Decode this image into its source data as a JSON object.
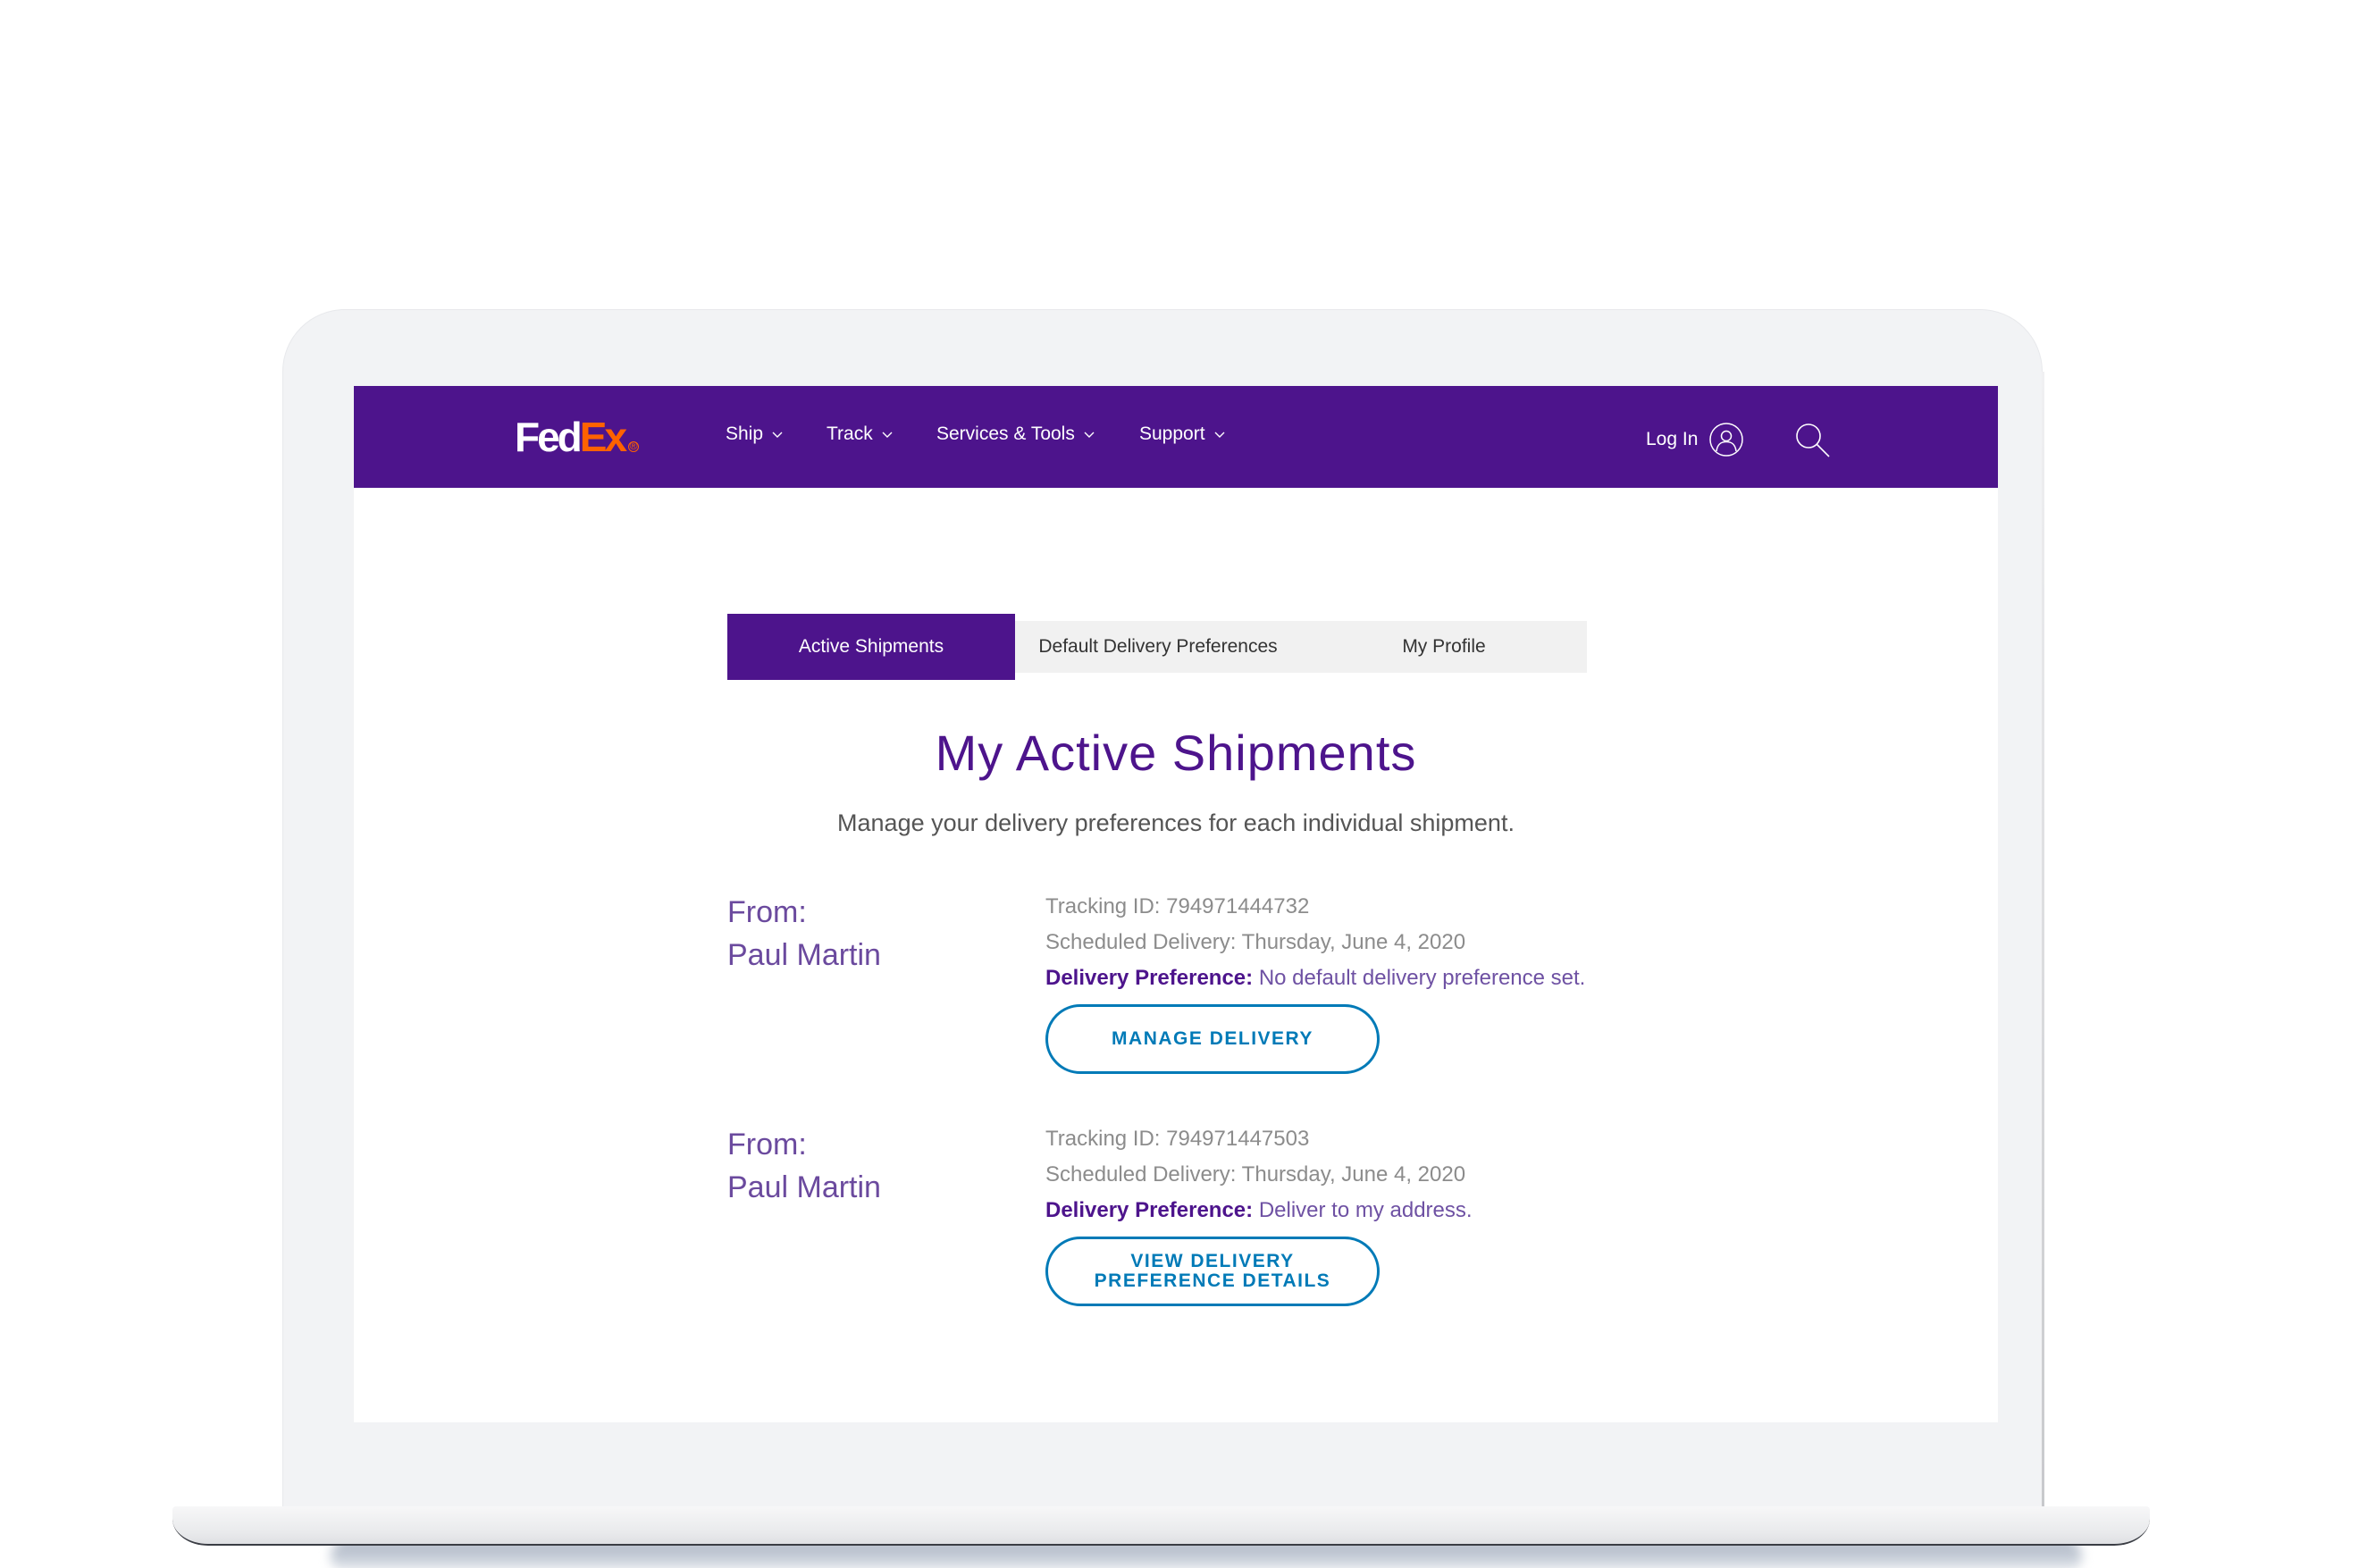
{
  "brand": {
    "logo_part1": "Fed",
    "logo_part2": "Ex",
    "logo_registered": "®",
    "colors": {
      "purple": "#4D148C",
      "orange": "#FF6200",
      "button_blue": "#007AB7"
    }
  },
  "nav": {
    "items": [
      {
        "label": "Ship",
        "icon": "chevron-down-icon"
      },
      {
        "label": "Track",
        "icon": "chevron-down-icon"
      },
      {
        "label": "Services & Tools",
        "icon": "chevron-down-icon"
      },
      {
        "label": "Support",
        "icon": "chevron-down-icon"
      }
    ],
    "login_label": "Log In",
    "login_icon": "user-icon",
    "search_icon": "search-icon"
  },
  "tabs": [
    {
      "label": "Active Shipments",
      "active": true
    },
    {
      "label": "Default Delivery Preferences",
      "active": false
    },
    {
      "label": "My Profile",
      "active": false
    }
  ],
  "page": {
    "title": "My Active Shipments",
    "subtitle": "Manage your delivery preferences for each individual shipment."
  },
  "shipments": [
    {
      "from_label": "From:",
      "sender": "Paul Martin",
      "tracking_id": "Tracking ID: 794971444732",
      "scheduled_delivery": "Scheduled Delivery: Thursday, June 4, 2020",
      "preference_label": "Delivery Preference:",
      "preference_value": "No default delivery preference set.",
      "button_line1": "MANAGE DELIVERY",
      "button_line2": ""
    },
    {
      "from_label": "From:",
      "sender": "Paul Martin",
      "tracking_id": "Tracking ID: 794971447503",
      "scheduled_delivery": "Scheduled Delivery: Thursday, June 4, 2020",
      "preference_label": "Delivery Preference:",
      "preference_value": "Deliver to my address.",
      "button_line1": "VIEW DELIVERY",
      "button_line2": "PREFERENCE DETAILS"
    }
  ]
}
